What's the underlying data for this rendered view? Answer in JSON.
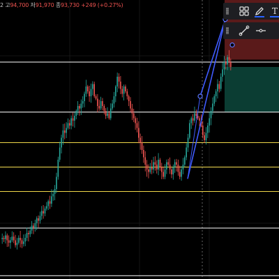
{
  "ohlc": {
    "open_suffix": "2",
    "high_label": "고",
    "high_value": "94,700",
    "low_label": "저",
    "low_value": "91,970",
    "close_label": "종",
    "close_value": "93,730",
    "change": "+249 (+0.27%)"
  },
  "toolbar": {
    "top_row": [
      "settings-grid-icon",
      "pencil-icon",
      "text-icon"
    ],
    "text_glyph": "T",
    "bottom_row": [
      "trendline-icon",
      "horizontal-ray-icon"
    ]
  },
  "colors": {
    "background": "#000000",
    "up_candle": "#26a69a",
    "down_candle": "#ef5350",
    "white_level": "#ffffff",
    "yellow_level": "#f0d84a",
    "channel": "#3f5bff",
    "long_profit_zone": "#0b3d33",
    "long_stop_zone": "#5a1a1a",
    "toolbar_bg": "#1e1e22",
    "accent": "#2962ff"
  },
  "chart_data": {
    "type": "candlestick",
    "ylim": [
      0,
      100
    ],
    "horizontal_levels": [
      {
        "y": 88,
        "color": "white"
      },
      {
        "y": 67.5,
        "color": "white"
      },
      {
        "y": 55,
        "color": "yellow"
      },
      {
        "y": 45,
        "color": "yellow"
      },
      {
        "y": 35,
        "color": "yellow"
      },
      {
        "y": 20,
        "color": "white"
      },
      {
        "y": 0.5,
        "color": "white"
      }
    ],
    "closes": [
      16,
      15.5,
      17,
      15,
      14,
      15,
      16.5,
      15,
      13,
      14,
      16,
      15,
      13.5,
      14.5,
      16,
      18,
      17.5,
      19,
      21,
      20,
      22,
      24,
      23,
      25,
      27,
      26,
      28,
      29,
      31,
      30,
      33,
      34,
      36,
      41,
      48,
      53,
      57,
      60,
      59,
      61,
      63,
      62,
      65,
      64,
      66,
      68,
      70,
      69,
      71,
      72,
      75,
      78,
      76,
      74,
      77,
      79,
      74,
      73,
      70,
      69,
      72,
      70,
      68,
      66,
      67,
      65,
      69,
      71,
      74,
      78,
      82,
      80,
      77,
      75,
      78,
      76,
      74,
      72,
      69,
      67,
      65,
      63,
      61,
      57,
      55,
      52,
      49,
      46,
      44,
      43,
      45,
      44,
      47,
      46,
      44,
      48,
      45,
      43,
      41,
      44,
      47,
      46,
      44,
      42,
      45,
      47,
      46,
      43,
      41,
      44,
      46,
      49,
      53,
      57,
      63,
      65,
      64,
      67,
      66,
      65,
      64,
      62,
      58,
      56,
      59,
      62,
      65,
      68,
      71,
      74,
      76,
      79,
      77,
      82,
      85,
      88,
      87,
      90,
      88,
      86
    ]
  }
}
